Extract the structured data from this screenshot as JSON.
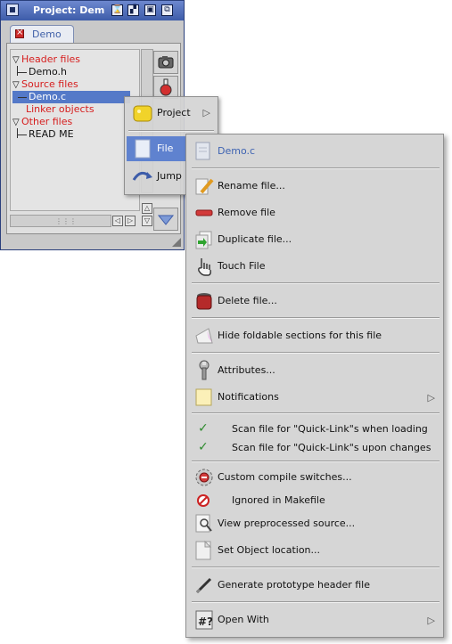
{
  "window": {
    "title": "Project:  Dem",
    "tab_label": "Demo"
  },
  "tree": {
    "header_files": "Header files",
    "demo_h": "Demo.h",
    "source_files": "Source files",
    "demo_c": "Demo.c",
    "linker_objects": "Linker objects",
    "other_files": "Other files",
    "read_me": "READ ME"
  },
  "popup": {
    "project": "Project",
    "file": "File",
    "jump": "Jump"
  },
  "submenu": {
    "header": "Demo.c",
    "rename": "Rename file...",
    "remove": "Remove file",
    "duplicate": "Duplicate file...",
    "touch": "Touch File",
    "delete": "Delete file...",
    "hide_foldable": "Hide foldable sections for this file",
    "attributes": "Attributes...",
    "notifications": "Notifications",
    "scan_loading": "Scan file for \"Quick-Link\"s when loading",
    "scan_changes": "Scan file for \"Quick-Link\"s upon changes",
    "custom_compile": "Custom compile switches...",
    "ignored_makefile": "Ignored in Makefile",
    "view_preprocessed": "View preprocessed source...",
    "set_object": "Set Object location...",
    "generate_prototype": "Generate prototype header file",
    "open_with": "Open With"
  },
  "colors": {
    "accent_blue": "#5479c8",
    "red_text": "#d61e1e",
    "menu_bg": "#d6d6d6"
  }
}
